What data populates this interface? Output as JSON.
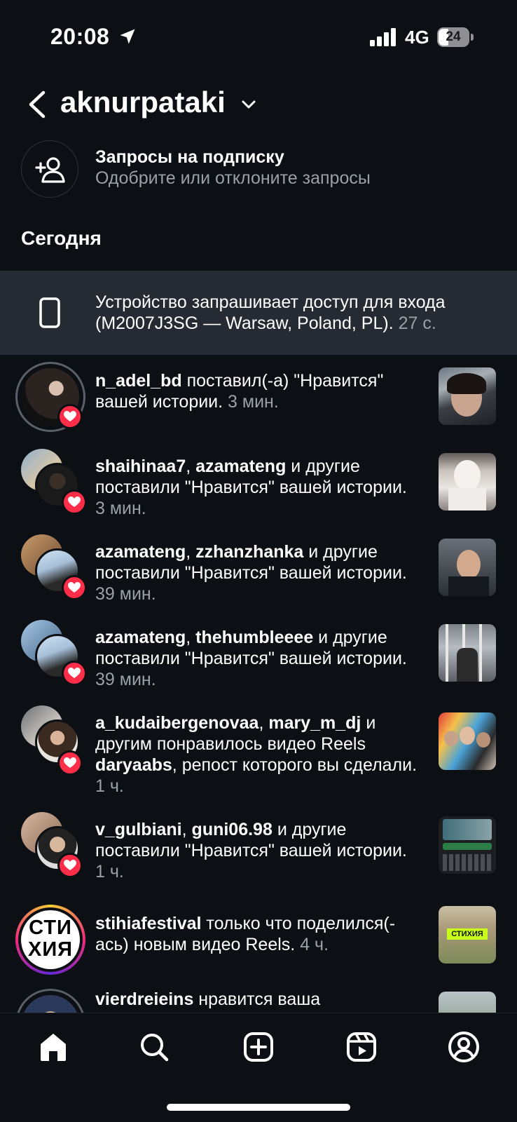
{
  "status_bar": {
    "time": "20:08",
    "network": "4G",
    "battery": "24"
  },
  "header": {
    "account_name": "aknurpataki"
  },
  "follow_requests": {
    "title": "Запросы на подписку",
    "subtitle": "Одобрите или отклоните запросы"
  },
  "section_today": "Сегодня",
  "device_banner": {
    "text": "Устройство запрашивает доступ для входа (M2007J3SG — Warsaw, Poland, PL).",
    "time": "27 с."
  },
  "notifications": [
    {
      "users": "n_adel_bd",
      "action": " поставил(-а) \"Нравится\" вашей истории.",
      "time": "3 мин."
    },
    {
      "users": "shaihinaa7",
      "sep": ", ",
      "users2": "azamateng",
      "action": " и другие поставили \"Нравится\" вашей истории.",
      "time": "3 мин."
    },
    {
      "users": "azamateng",
      "sep": ", ",
      "users2": "zzhanzhanka",
      "action": " и другие поставили \"Нравится\" вашей истории.",
      "time": "39 мин."
    },
    {
      "users": "azamateng",
      "sep": ", ",
      "users2": "thehumbleeee",
      "action": " и другие поставили \"Нравится\" вашей истории.",
      "time": "39 мин."
    },
    {
      "users": "a_kudaibergenovaa",
      "sep": ", ",
      "users2": "mary_m_dj",
      "action": " и другим понравилось видео Reels ",
      "users3": "daryaabs",
      "action2": ", репост которого вы сделали.",
      "time": "1 ч."
    },
    {
      "users": "v_gulbiani",
      "sep": ", ",
      "users2": "guni06.98",
      "action": " и другие поставили \"Нравится\" вашей истории.",
      "time": "1 ч."
    },
    {
      "users": "stihiafestival",
      "action": " только что поделился(-ась) новым видео Reels.",
      "time": "4 ч.",
      "avatar_text": "СТИ ХИЯ",
      "thumb_text": "СТИХИЯ"
    },
    {
      "users": "vierdreieins",
      "action": " нравится ваша"
    }
  ],
  "colors": {
    "background": "#0c0f14",
    "banner": "#262b33",
    "heart": "#ff2d47",
    "muted": "#9aa0a6"
  },
  "icons": [
    "location-arrow-icon",
    "signal-icon",
    "back-chevron-icon",
    "chevron-down-icon",
    "add-person-icon",
    "phone-icon",
    "heart-icon",
    "home-icon",
    "search-icon",
    "create-icon",
    "reels-icon",
    "profile-icon"
  ]
}
